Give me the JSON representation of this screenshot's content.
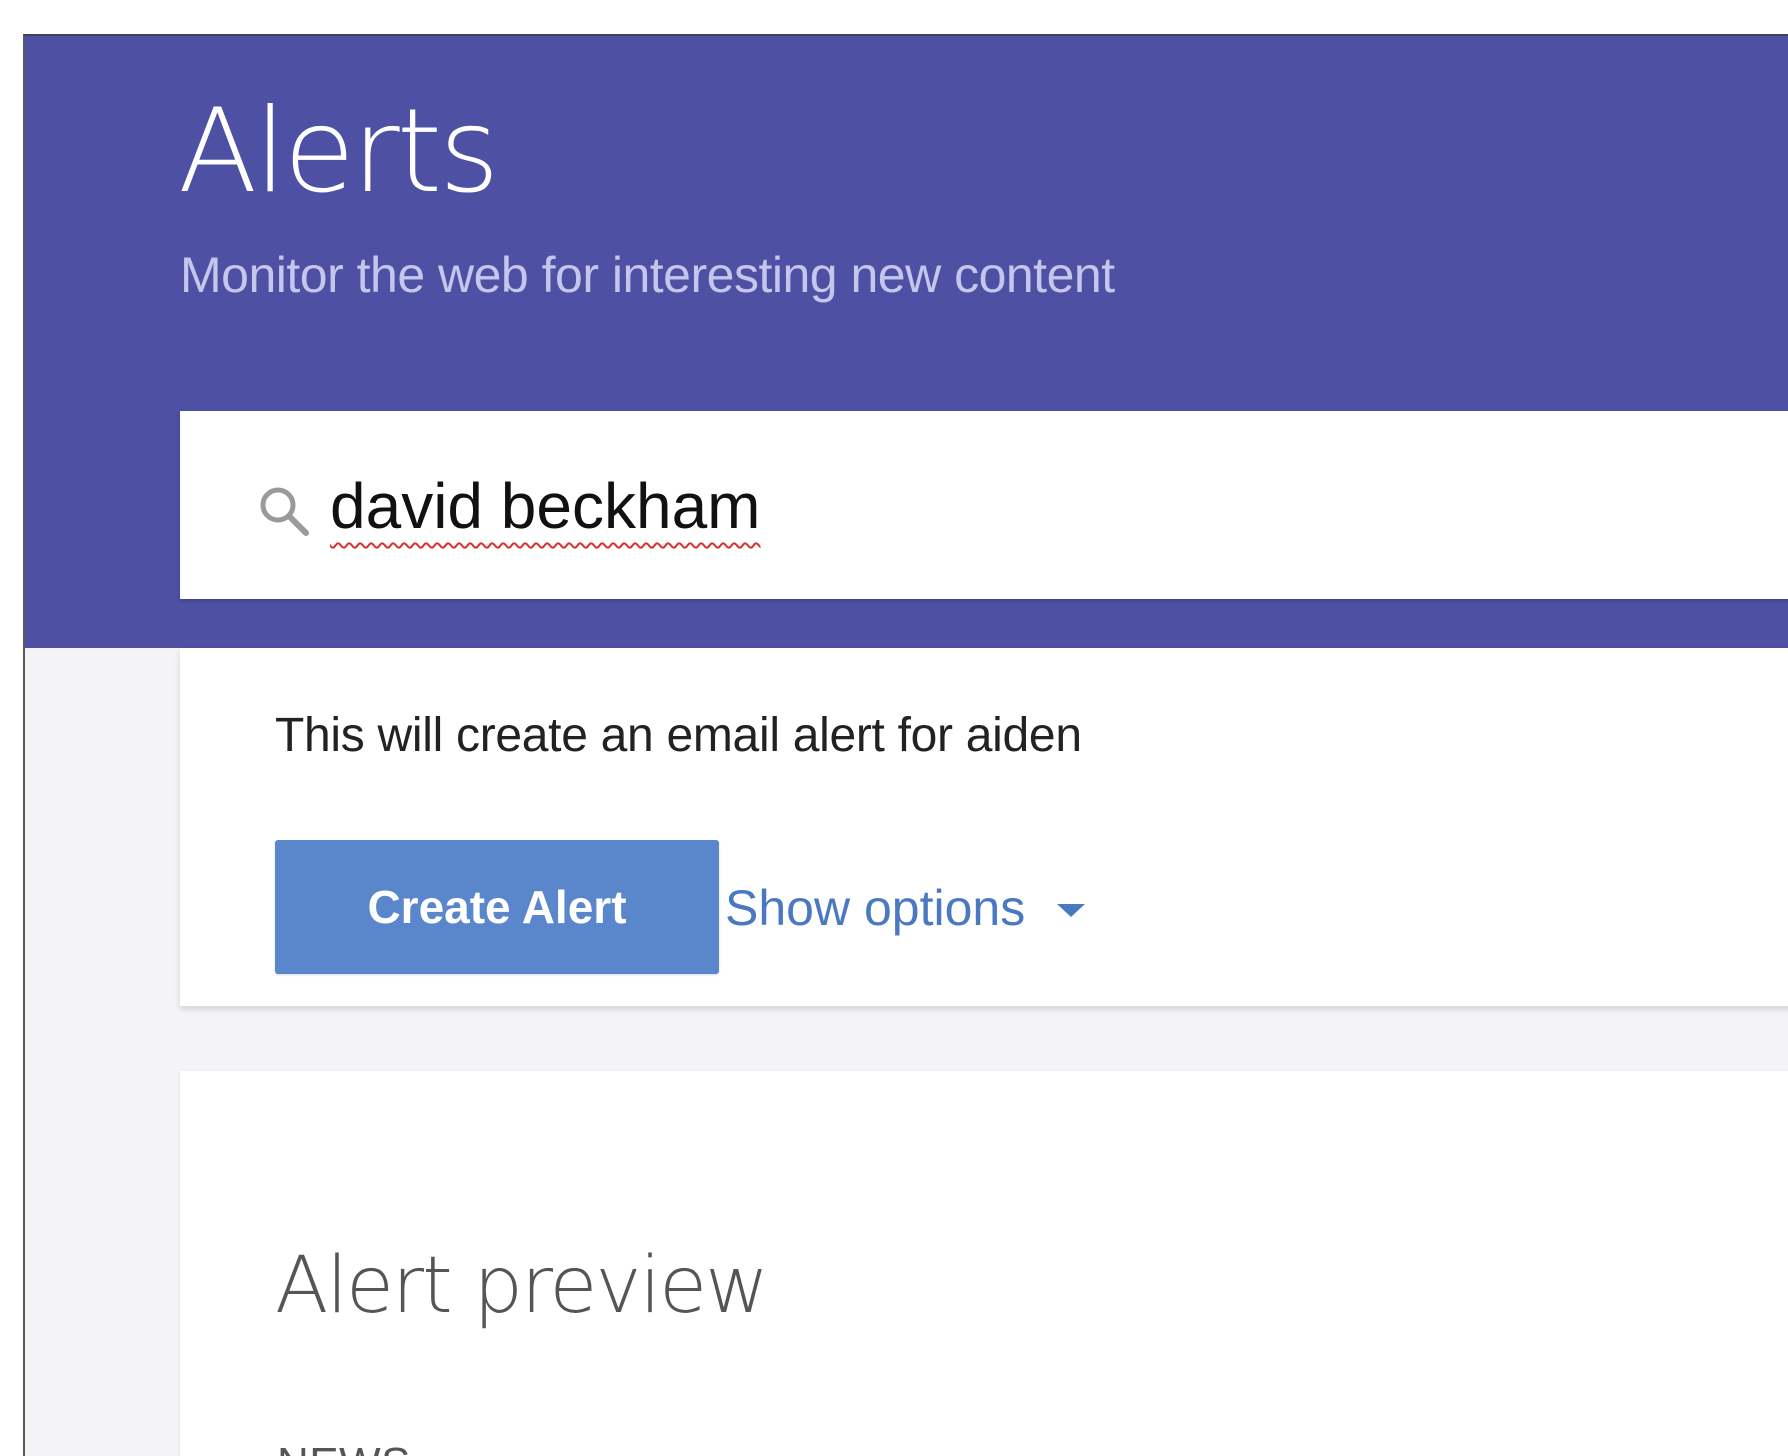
{
  "header": {
    "title": "Alerts",
    "subtitle": "Monitor the web for interesting new content",
    "background_color": "#4d50a3"
  },
  "search": {
    "icon": "search-icon",
    "value": "david beckham"
  },
  "create_panel": {
    "email_note": "This will create an email alert for aiden",
    "create_button_label": "Create Alert",
    "show_options_label": "Show options",
    "show_options_icon": "chevron-down-icon",
    "button_color": "#5a86cc",
    "link_color": "#4a79c2"
  },
  "preview": {
    "title": "Alert preview",
    "section_label": "NEWS"
  }
}
